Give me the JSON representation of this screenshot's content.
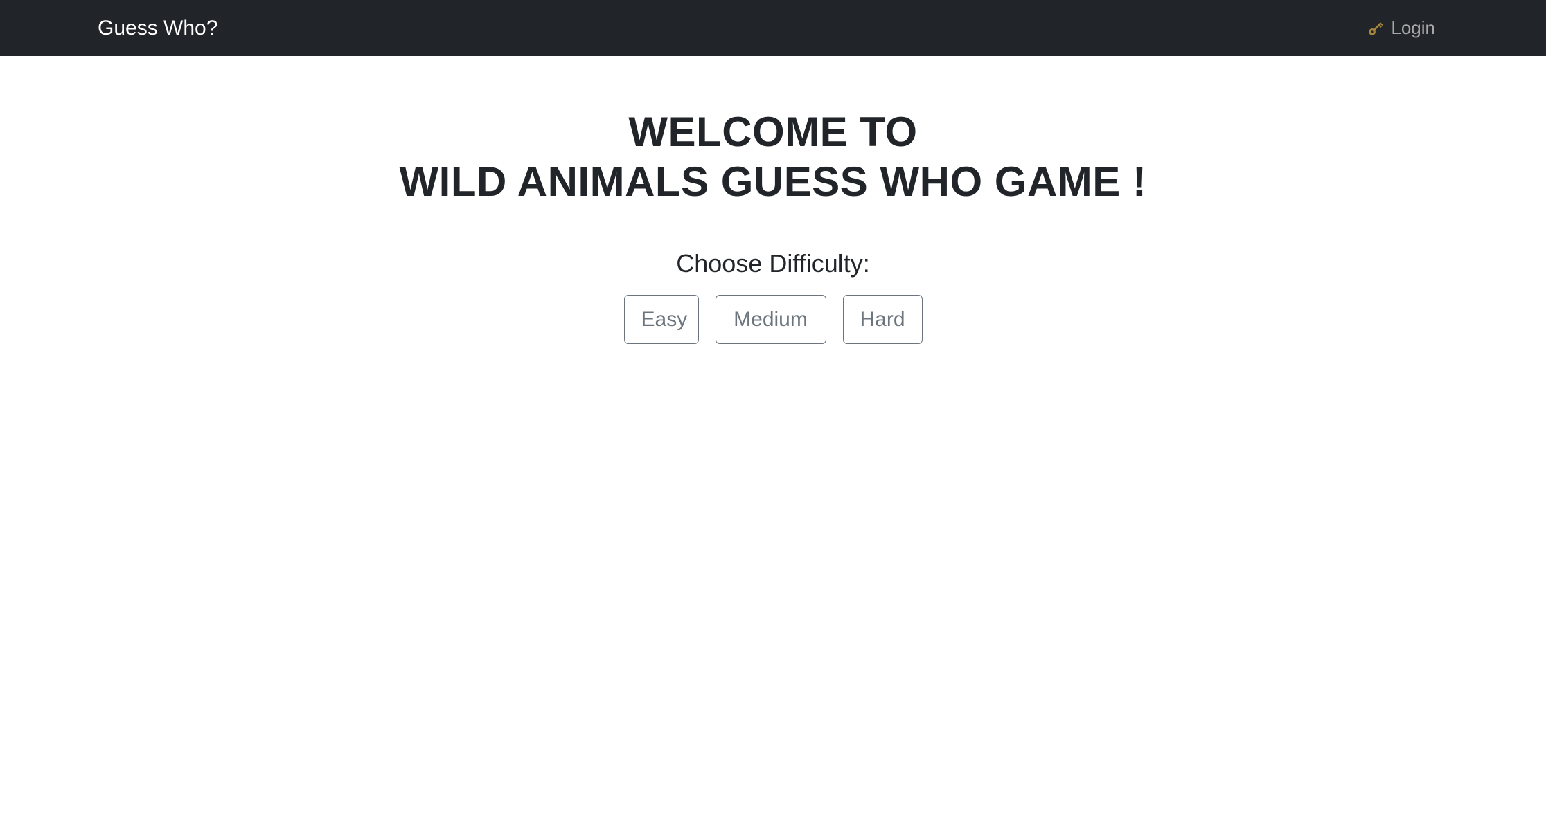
{
  "navbar": {
    "brand": "Guess Who?",
    "login_label": "Login",
    "login_icon": "key-icon",
    "background_color": "#212529"
  },
  "main": {
    "title_line1": "WELCOME TO",
    "title_line2": "WILD ANIMALS GUESS WHO GAME !",
    "difficulty_label": "Choose Difficulty:",
    "buttons": [
      {
        "label": "Easy"
      },
      {
        "label": "Medium"
      },
      {
        "label": "Hard"
      }
    ]
  },
  "colors": {
    "text": "#212529",
    "button_outline": "#6c757d",
    "key_icon": "#c9a14a"
  }
}
